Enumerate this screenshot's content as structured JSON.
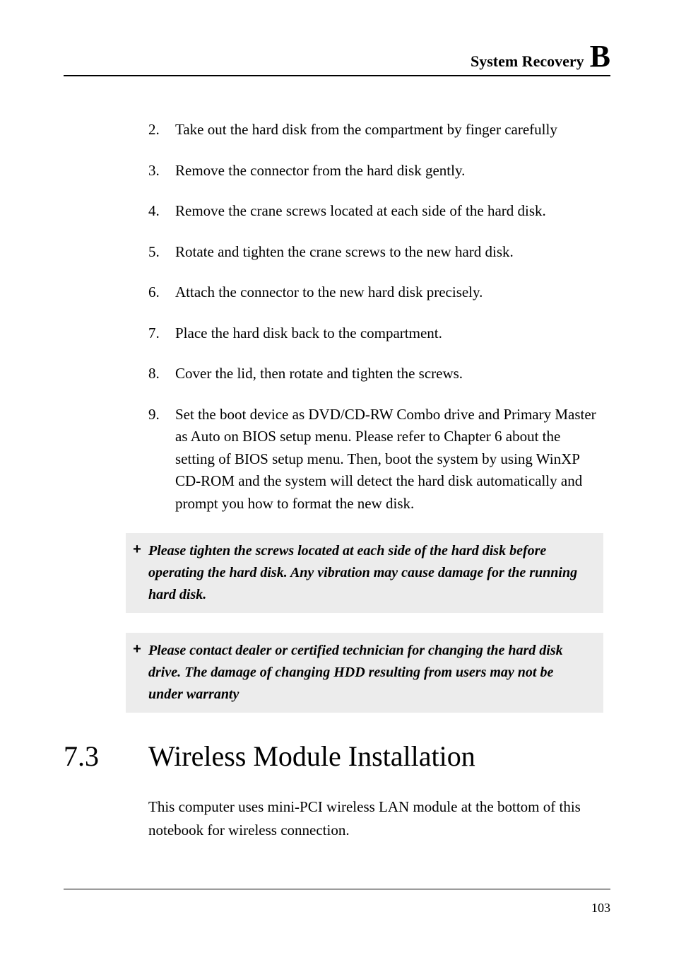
{
  "header": {
    "title": "System Recovery",
    "letter": "B"
  },
  "list": [
    {
      "num": "2.",
      "text": "Take out the hard disk from the compartment by finger carefully"
    },
    {
      "num": "3.",
      "text": "Remove the connector from the hard disk gently."
    },
    {
      "num": "4.",
      "text": "Remove the crane screws located at each side of the hard disk."
    },
    {
      "num": "5.",
      "text": "Rotate and tighten the crane screws to the new hard disk."
    },
    {
      "num": "6.",
      "text": "Attach the connector to the new hard disk precisely."
    },
    {
      "num": "7.",
      "text": "Place the hard disk back to the compartment."
    },
    {
      "num": "8.",
      "text": "Cover the lid, then rotate and tighten the screws."
    },
    {
      "num": "9.",
      "text": "Set the boot device as DVD/CD-RW Combo drive and Primary Master as Auto on BIOS setup menu. Please refer to Chapter 6 about the setting of BIOS setup menu. Then, boot the system by using WinXP CD-ROM and the system will detect the hard disk automatically and prompt you how to format the new disk."
    }
  ],
  "notes": [
    {
      "marker": "+",
      "text": "Please tighten the screws located at each side of the hard disk before operating the hard disk. Any vibration may cause damage for the running hard disk."
    },
    {
      "marker": "+",
      "text": "Please contact dealer or certified technician for changing the hard disk drive. The damage of changing HDD resulting from users may not be under warranty"
    }
  ],
  "section": {
    "num": "7.3",
    "title": "Wireless Module Installation"
  },
  "para": "This computer uses mini-PCI wireless LAN module at the bottom of this notebook for wireless connection.",
  "page_number": "103"
}
